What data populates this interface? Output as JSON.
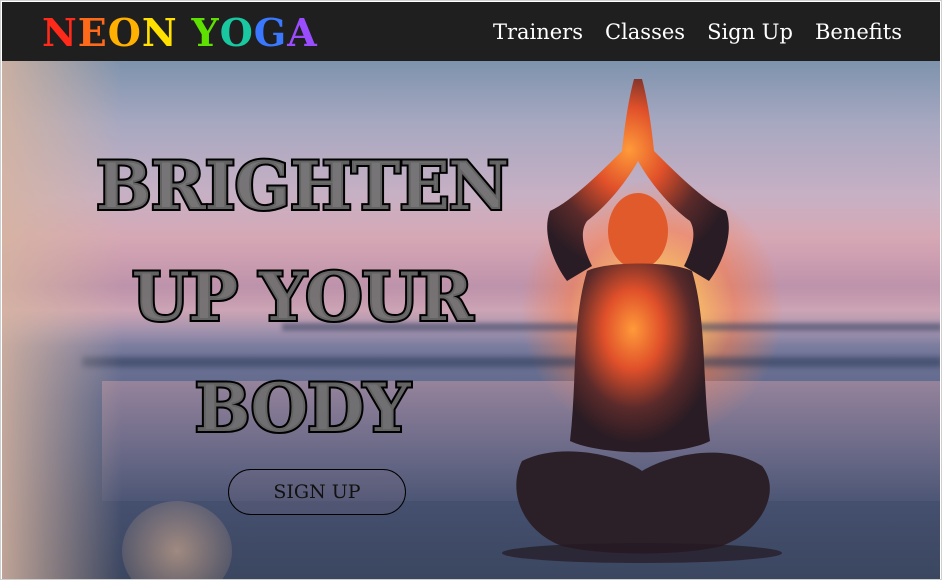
{
  "brand": {
    "letters": [
      "N",
      "E",
      "O",
      "N",
      " ",
      "Y",
      "O",
      "G",
      "A"
    ],
    "colors": [
      "#ff2a1a",
      "#ff6a1a",
      "#ffb000",
      "#ffe000",
      "#ffffff",
      "#5ee000",
      "#19c8a0",
      "#3a78ff",
      "#9a4cff"
    ]
  },
  "nav": {
    "items": [
      {
        "label": "Trainers"
      },
      {
        "label": "Classes"
      },
      {
        "label": "Sign Up"
      },
      {
        "label": "Benefits"
      }
    ]
  },
  "hero": {
    "headline": [
      "BRIGHTEN",
      "UP YOUR",
      "BODY"
    ],
    "cta_label": "SIGN UP"
  }
}
